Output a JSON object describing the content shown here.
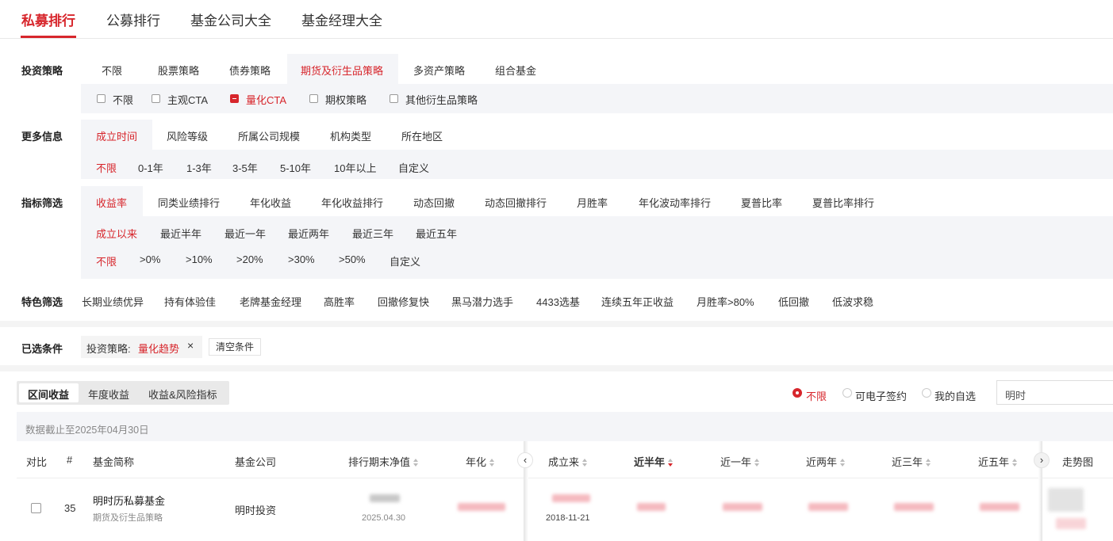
{
  "top_tabs": [
    "私募排行",
    "公募排行",
    "基金公司大全",
    "基金经理大全"
  ],
  "strategy": {
    "label": "投资策略",
    "options": [
      "不限",
      "股票策略",
      "债券策略",
      "期货及衍生品策略",
      "多资产策略",
      "组合基金"
    ],
    "sub_options": [
      "不限",
      "主观CTA",
      "量化CTA",
      "期权策略",
      "其他衍生品策略"
    ]
  },
  "more_info": {
    "label": "更多信息",
    "tabs": [
      "成立时间",
      "风险等级",
      "所属公司规模",
      "机构类型",
      "所在地区"
    ],
    "options": [
      "不限",
      "0-1年",
      "1-3年",
      "3-5年",
      "5-10年",
      "10年以上",
      "自定义"
    ]
  },
  "metric": {
    "label": "指标筛选",
    "tabs": [
      "收益率",
      "同类业绩排行",
      "年化收益",
      "年化收益排行",
      "动态回撤",
      "动态回撤排行",
      "月胜率",
      "年化波动率排行",
      "夏普比率",
      "夏普比率排行"
    ],
    "periods": [
      "成立以来",
      "最近半年",
      "最近一年",
      "最近两年",
      "最近三年",
      "最近五年"
    ],
    "ranges": [
      "不限",
      ">0%",
      ">10%",
      ">20%",
      ">30%",
      ">50%",
      "自定义"
    ]
  },
  "feature": {
    "label": "特色筛选",
    "options": [
      "长期业绩优异",
      "持有体验佳",
      "老牌基金经理",
      "高胜率",
      "回撤修复快",
      "黑马潜力选手",
      "4433选基",
      "连续五年正收益",
      "月胜率>80%",
      "低回撤",
      "低波求稳"
    ]
  },
  "selected": {
    "label": "已选条件",
    "tag_key": "投资策略:",
    "tag_value": "量化趋势",
    "close": "×",
    "clear": "清空条件"
  },
  "views": [
    "区间收益",
    "年度收益",
    "收益&风险指标"
  ],
  "radios": [
    "不限",
    "可电子签约",
    "我的自选"
  ],
  "search_value": "明时",
  "data_note": "数据截止至2025年04月30日",
  "table": {
    "headers": [
      "对比",
      "#",
      "基金简称",
      "基金公司",
      "排行期末净值",
      "年化",
      "成立来",
      "近半年",
      "近一年",
      "近两年",
      "近三年",
      "近五年",
      "走势图"
    ],
    "row": {
      "rank": "35",
      "name": "明时历私募基金",
      "category": "期货及衍生品策略",
      "company": "明时投资",
      "nav_date": "2025.04.30",
      "inception_date": "2018-11-21"
    }
  },
  "icons": {
    "prev": "chevron-left-icon",
    "next": "chevron-right-icon",
    "close": "close-icon"
  },
  "colors": {
    "accent": "#d7262c"
  }
}
